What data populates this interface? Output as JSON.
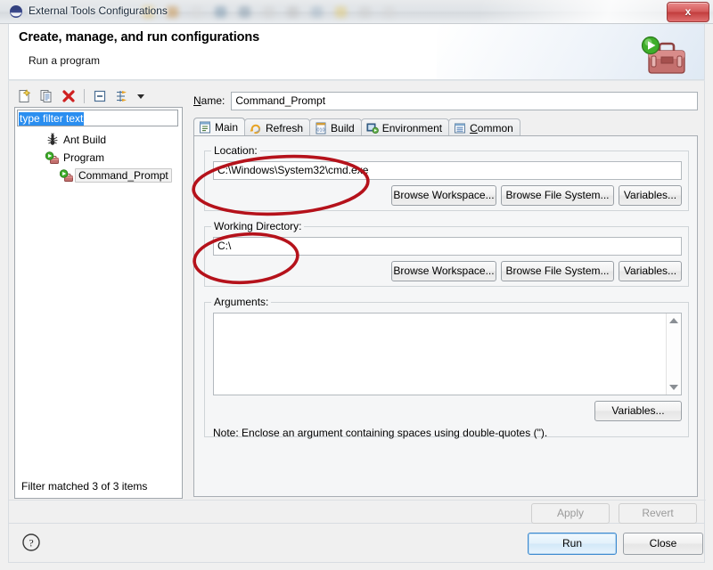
{
  "window": {
    "title": "External Tools Configurations",
    "title_icon": "eclipse-sphere-icon",
    "close_label": "x"
  },
  "banner": {
    "title": "Create, manage, and run configurations",
    "subtitle": "Run a program",
    "icon": "toolbox-with-run-arrow-icon"
  },
  "tree_toolbar": {
    "buttons": [
      {
        "name": "new-configuration-button",
        "icon": "new-document-icon"
      },
      {
        "name": "duplicate-configuration-button",
        "icon": "copy-document-icon"
      },
      {
        "name": "delete-configuration-button",
        "icon": "red-x-delete-icon"
      },
      {
        "name": "collapse-all-button",
        "icon": "collapse-all-icon"
      },
      {
        "name": "filter-configurations-button",
        "icon": "filter-arrows-icon"
      }
    ],
    "dropdown_icon": "chevron-down-icon"
  },
  "tree": {
    "filter_placeholder": "type filter text",
    "filter_value": "type filter text",
    "items": [
      {
        "label": "Ant Build",
        "icon": "ant-build-icon",
        "level": 1,
        "selected": false
      },
      {
        "label": "Program",
        "icon": "program-run-icon",
        "level": 1,
        "selected": false
      },
      {
        "label": "Command_Prompt",
        "icon": "program-run-icon",
        "level": 2,
        "selected": true
      }
    ],
    "status": "Filter matched 3 of 3 items"
  },
  "config": {
    "name_label": "Name:",
    "name_value": "Command_Prompt",
    "tabs": [
      {
        "label": "Main",
        "icon": "main-tab-icon",
        "active": true
      },
      {
        "label": "Refresh",
        "icon": "refresh-tab-icon",
        "active": false
      },
      {
        "label": "Build",
        "icon": "build-tab-icon",
        "active": false
      },
      {
        "label": "Environment",
        "icon": "environment-tab-icon",
        "active": false
      },
      {
        "label": "Common",
        "icon": "common-tab-icon",
        "active": false
      }
    ],
    "location": {
      "legend": "Location:",
      "value": "C:\\Windows\\System32\\cmd.exe",
      "browse_workspace": "Browse Workspace...",
      "browse_file_system": "Browse File System...",
      "variables": "Variables..."
    },
    "working_directory": {
      "legend": "Working Directory:",
      "value": "C:\\",
      "browse_workspace": "Browse Workspace...",
      "browse_file_system": "Browse File System...",
      "variables": "Variables..."
    },
    "arguments": {
      "legend": "Arguments:",
      "value": "",
      "variables": "Variables...",
      "note": "Note: Enclose an argument containing spaces using double-quotes (\")."
    },
    "apply_label": "Apply",
    "revert_label": "Revert"
  },
  "footer": {
    "help_icon": "help-question-icon",
    "run_label": "Run",
    "close_label": "Close"
  },
  "annotations": {
    "color": "#b5121b",
    "shapes": [
      {
        "name": "location-field-highlight"
      },
      {
        "name": "working-directory-field-highlight"
      }
    ]
  },
  "colors": {
    "accent": "#3c8ad0",
    "annotation_red": "#b5121b",
    "dialog_bg": "#f0f0f0",
    "selection_blue": "#2a8ef0"
  }
}
